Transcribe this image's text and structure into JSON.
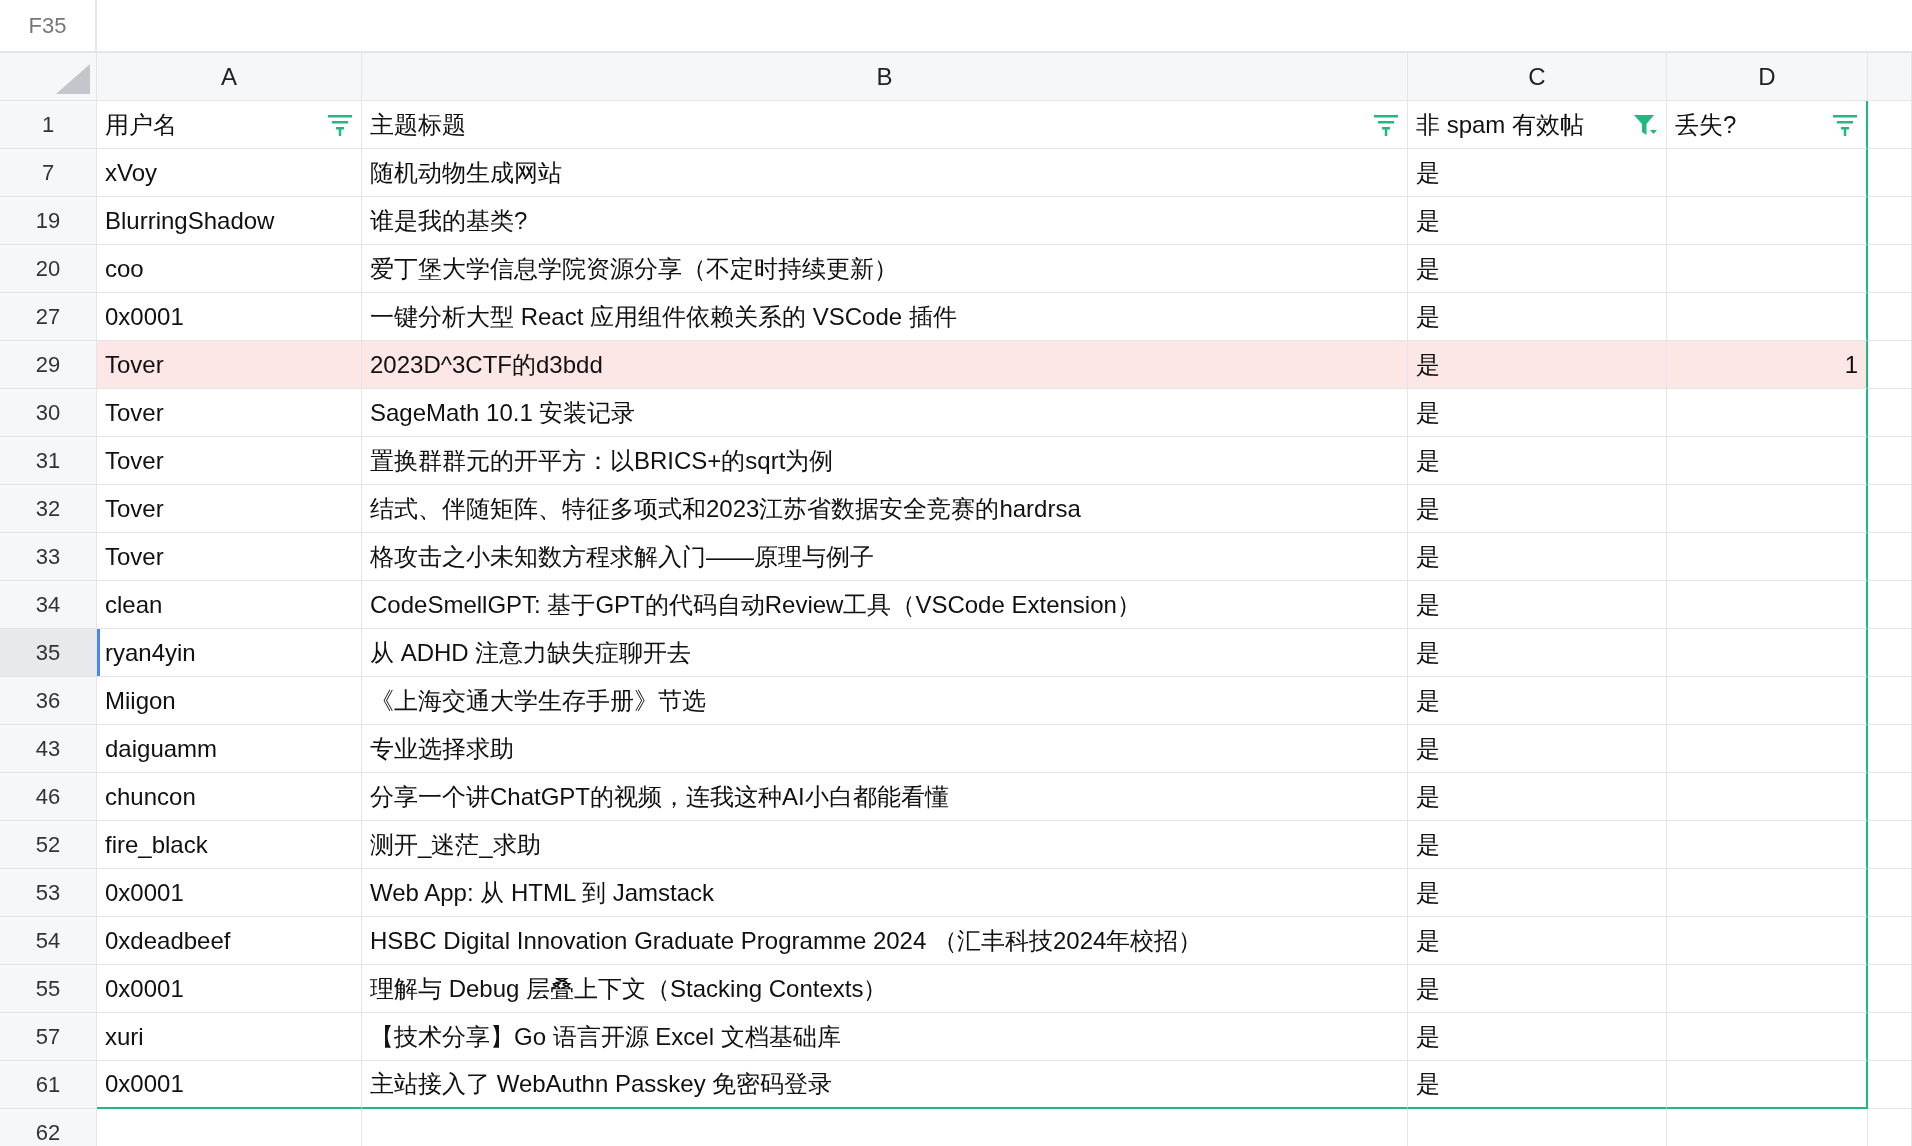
{
  "name_box": "F35",
  "columns": [
    {
      "letter": "A",
      "header": "用户名",
      "filter_active": false
    },
    {
      "letter": "B",
      "header": "主题标题",
      "filter_active": false
    },
    {
      "letter": "C",
      "header": "非 spam 有效帖",
      "filter_active": true
    },
    {
      "letter": "D",
      "header": "丢失?",
      "filter_active": false
    }
  ],
  "header_row_number": "1",
  "rows": [
    {
      "row_number": "7",
      "cells": [
        "xVoy",
        "随机动物生成网站",
        "是",
        ""
      ],
      "highlighted": false,
      "selected": false
    },
    {
      "row_number": "19",
      "cells": [
        "BlurringShadow",
        "谁是我的基类?",
        "是",
        ""
      ],
      "highlighted": false,
      "selected": false
    },
    {
      "row_number": "20",
      "cells": [
        "coo",
        "爱丁堡大学信息学院资源分享（不定时持续更新）",
        "是",
        ""
      ],
      "highlighted": false,
      "selected": false
    },
    {
      "row_number": "27",
      "cells": [
        "0x0001",
        "一键分析大型 React 应用组件依赖关系的 VSCode 插件",
        "是",
        ""
      ],
      "highlighted": false,
      "selected": false
    },
    {
      "row_number": "29",
      "cells": [
        "Tover",
        "2023D^3CTF的d3bdd",
        "是",
        "1"
      ],
      "highlighted": true,
      "selected": false
    },
    {
      "row_number": "30",
      "cells": [
        "Tover",
        "SageMath 10.1 安装记录",
        "是",
        ""
      ],
      "highlighted": false,
      "selected": false
    },
    {
      "row_number": "31",
      "cells": [
        "Tover",
        "置换群群元的开平方：以BRICS+的sqrt为例",
        "是",
        ""
      ],
      "highlighted": false,
      "selected": false
    },
    {
      "row_number": "32",
      "cells": [
        "Tover",
        "结式、伴随矩阵、特征多项式和2023江苏省数据安全竞赛的hardrsa",
        "是",
        ""
      ],
      "highlighted": false,
      "selected": false
    },
    {
      "row_number": "33",
      "cells": [
        "Tover",
        "格攻击之小未知数方程求解入门——原理与例子",
        "是",
        ""
      ],
      "highlighted": false,
      "selected": false
    },
    {
      "row_number": "34",
      "cells": [
        "clean",
        "CodeSmellGPT: 基于GPT的代码自动Review工具（VSCode Extension）",
        "是",
        ""
      ],
      "highlighted": false,
      "selected": false
    },
    {
      "row_number": "35",
      "cells": [
        "ryan4yin",
        "从 ADHD 注意力缺失症聊开去",
        "是",
        ""
      ],
      "highlighted": false,
      "selected": true
    },
    {
      "row_number": "36",
      "cells": [
        "Miigon",
        "《上海交通大学生存手册》节选",
        "是",
        ""
      ],
      "highlighted": false,
      "selected": false
    },
    {
      "row_number": "43",
      "cells": [
        "daiguamm",
        "专业选择求助",
        "是",
        ""
      ],
      "highlighted": false,
      "selected": false
    },
    {
      "row_number": "46",
      "cells": [
        "chuncon",
        "分享一个讲ChatGPT的视频，连我这种AI小白都能看懂",
        "是",
        ""
      ],
      "highlighted": false,
      "selected": false
    },
    {
      "row_number": "52",
      "cells": [
        "fire_black",
        "测开_迷茫_求助",
        "是",
        ""
      ],
      "highlighted": false,
      "selected": false
    },
    {
      "row_number": "53",
      "cells": [
        "0x0001",
        "Web App: 从 HTML 到 Jamstack",
        "是",
        ""
      ],
      "highlighted": false,
      "selected": false
    },
    {
      "row_number": "54",
      "cells": [
        "0xdeadbeef",
        "HSBC Digital Innovation Graduate Programme 2024 （汇丰科技2024年校招）",
        "是",
        ""
      ],
      "highlighted": false,
      "selected": false
    },
    {
      "row_number": "55",
      "cells": [
        "0x0001",
        "理解与 Debug 层叠上下文（Stacking Contexts）",
        "是",
        ""
      ],
      "highlighted": false,
      "selected": false
    },
    {
      "row_number": "57",
      "cells": [
        "xuri",
        "【技术分享】Go 语言开源 Excel 文档基础库",
        "是",
        ""
      ],
      "highlighted": false,
      "selected": false
    },
    {
      "row_number": "61",
      "cells": [
        "0x0001",
        "主站接入了 WebAuthn Passkey 免密码登录",
        "是",
        ""
      ],
      "highlighted": false,
      "selected": false
    }
  ],
  "empty_row_number": "62"
}
